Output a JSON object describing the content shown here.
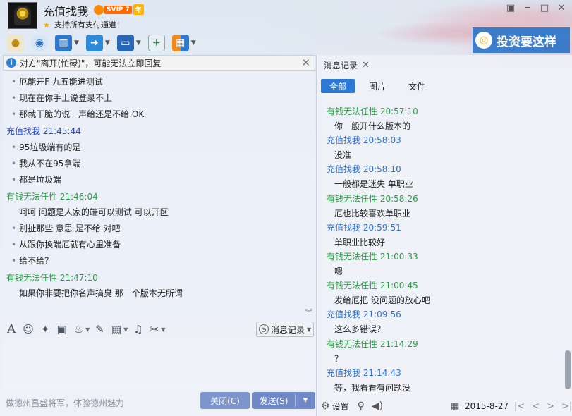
{
  "header": {
    "contact_name": "充值找我",
    "svip_label": "SVIP 7",
    "year_label": "年",
    "status_text": "支持所有支付通道！"
  },
  "toolbar": {
    "icons": [
      "microphone-icon",
      "video-call-icon",
      "screen-share-icon",
      "file-transfer-icon",
      "remote-desktop-icon",
      "add-app-icon",
      "apps-icon"
    ]
  },
  "ad": {
    "text": "投资要这样"
  },
  "notice": {
    "text": "对方\"离开(忙碌)\"，可能无法立即回复"
  },
  "chat": {
    "messages": [
      {
        "kind": "bullet",
        "text": "厄能开F 九五能进测试"
      },
      {
        "kind": "bullet",
        "text": "现在在你手上说登录不上"
      },
      {
        "kind": "bullet",
        "text": "那就干脆的说一声给还是不给  OK"
      },
      {
        "kind": "sender-self",
        "text": "充值找我   21:45:44"
      },
      {
        "kind": "bullet",
        "text": "95垃圾端有的是"
      },
      {
        "kind": "bullet",
        "text": "我从不在95拿端"
      },
      {
        "kind": "bullet",
        "text": "都是垃圾端"
      },
      {
        "kind": "sender-other",
        "text": "有钱无法任性   21:46:04"
      },
      {
        "kind": "plain",
        "text": "呵呵 问题是人家的端可以测试 可以开区"
      },
      {
        "kind": "bullet",
        "text": "别扯那些 意思 是不给 对吧"
      },
      {
        "kind": "bullet",
        "text": "从跟你换端厄就有心里准备"
      },
      {
        "kind": "bullet",
        "text": "给不给？"
      },
      {
        "kind": "sender-other",
        "text": "有钱无法任性   21:47:10"
      },
      {
        "kind": "plain",
        "text": "如果你非要把你名声搞臭 那一个版本无所谓"
      }
    ]
  },
  "input": {
    "history_label": "消息记录",
    "promo_text": "做德州昌盛将军，体验德州魅力",
    "close_label": "关闭(C)",
    "send_label": "发送(S)"
  },
  "history": {
    "tab_label": "消息记录",
    "filters": [
      "全部",
      "图片",
      "文件"
    ],
    "entries": [
      {
        "sender": "有钱无法任性",
        "time": "20:57:10",
        "who": "other",
        "text": "你一般开什么版本的"
      },
      {
        "sender": "充值找我",
        "time": "20:58:03",
        "who": "self",
        "text": "没准"
      },
      {
        "sender": "充值找我",
        "time": "20:58:10",
        "who": "self",
        "text": "一般都是迷失 单职业"
      },
      {
        "sender": "有钱无法任性",
        "time": "20:58:26",
        "who": "other",
        "text": "厄也比较喜欢单职业"
      },
      {
        "sender": "充值找我",
        "time": "20:59:51",
        "who": "self",
        "text": "单职业比较好"
      },
      {
        "sender": "有钱无法任性",
        "time": "21:00:33",
        "who": "other",
        "text": "嗯"
      },
      {
        "sender": "有钱无法任性",
        "time": "21:00:45",
        "who": "other",
        "text": "发给厄把  没问题的放心吧"
      },
      {
        "sender": "充值找我",
        "time": "21:09:56",
        "who": "self",
        "text": "这么多错误？"
      },
      {
        "sender": "有钱无法任性",
        "time": "21:14:29",
        "who": "other",
        "text": "？"
      },
      {
        "sender": "充值找我",
        "time": "21:14:43",
        "who": "self",
        "text": "等，我看看有问题没"
      }
    ],
    "settings_label": "设置",
    "date": "2015-8-27"
  }
}
